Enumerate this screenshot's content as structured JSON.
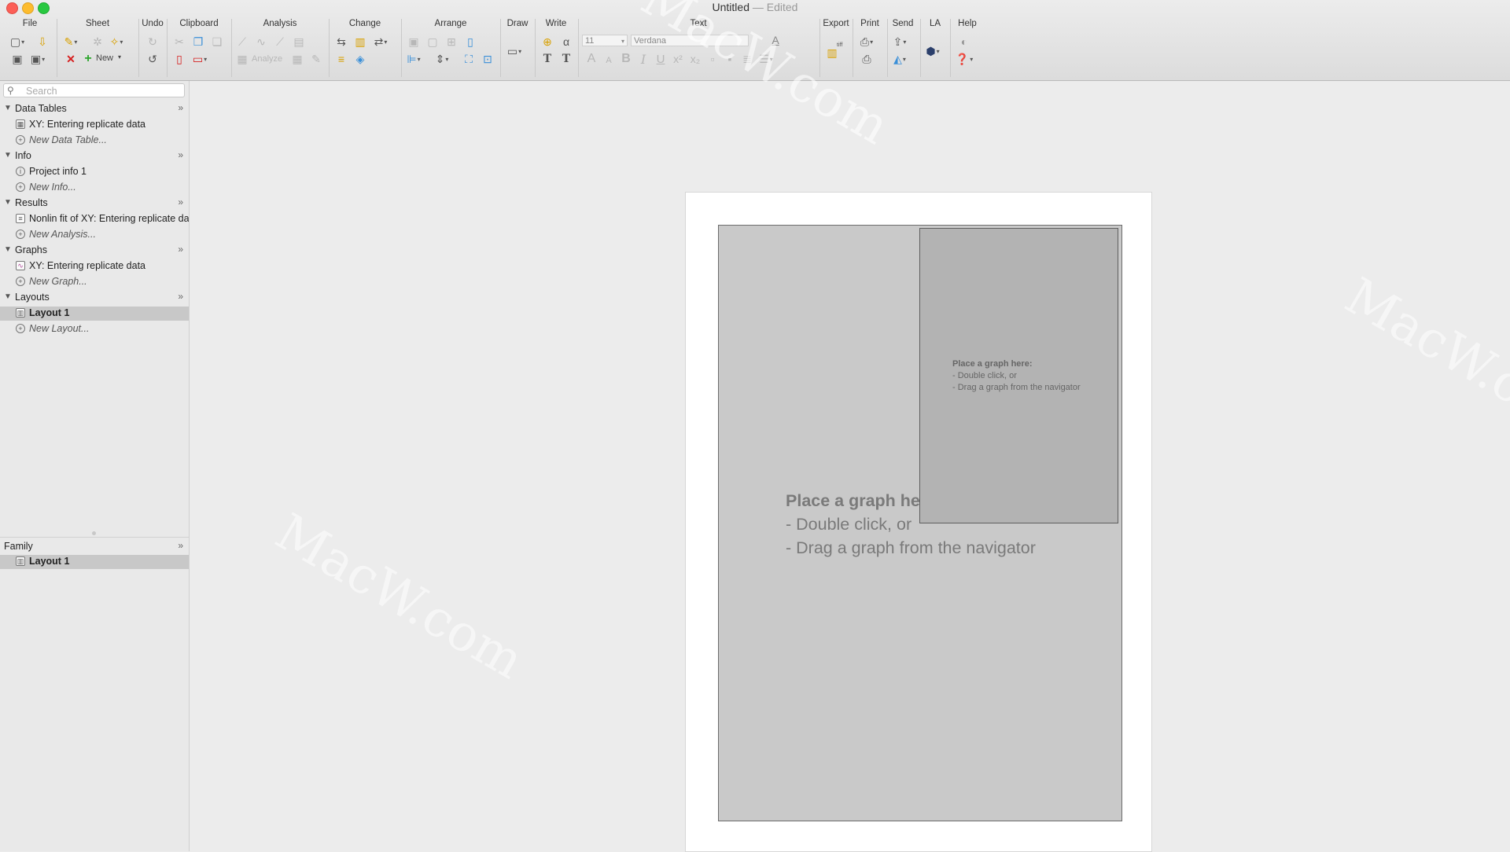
{
  "window": {
    "title": "Untitled",
    "subtitle": "— Edited"
  },
  "toolbar": {
    "groups": {
      "file": "File",
      "sheet": "Sheet",
      "undo": "Undo",
      "clipboard": "Clipboard",
      "analysis": "Analysis",
      "change": "Change",
      "arrange": "Arrange",
      "draw": "Draw",
      "write": "Write",
      "text": "Text",
      "export": "Export",
      "print": "Print",
      "send": "Send",
      "la": "LA",
      "help": "Help"
    },
    "new_label": "New",
    "analyze_label": "Analyze",
    "font_size": "11",
    "font_name": "Verdana",
    "export_badge": "tiff"
  },
  "search": {
    "placeholder": "Search"
  },
  "navigator": {
    "data_tables": {
      "title": "Data Tables",
      "items": [
        "XY: Entering replicate data"
      ],
      "new": "New Data Table..."
    },
    "info": {
      "title": "Info",
      "items": [
        "Project info 1"
      ],
      "new": "New Info..."
    },
    "results": {
      "title": "Results",
      "items": [
        "Nonlin fit of XY: Entering replicate data"
      ],
      "new": "New Analysis..."
    },
    "graphs": {
      "title": "Graphs",
      "items": [
        "XY: Entering replicate data"
      ],
      "new": "New Graph..."
    },
    "layouts": {
      "title": "Layouts",
      "items": [
        "Layout 1"
      ],
      "new": "New Layout..."
    }
  },
  "family": {
    "title": "Family",
    "items": [
      "Layout 1"
    ]
  },
  "layout": {
    "placeholder_heading": "Place a graph here:",
    "placeholder_line1": "- Double click, or",
    "placeholder_line2": "- Drag a graph from the navigator"
  },
  "watermark": "MacW.com",
  "colors": {
    "selected_row": "#c8c8c8",
    "placeholder_large": "#c9c9c9",
    "placeholder_small": "#b3b3b3"
  }
}
